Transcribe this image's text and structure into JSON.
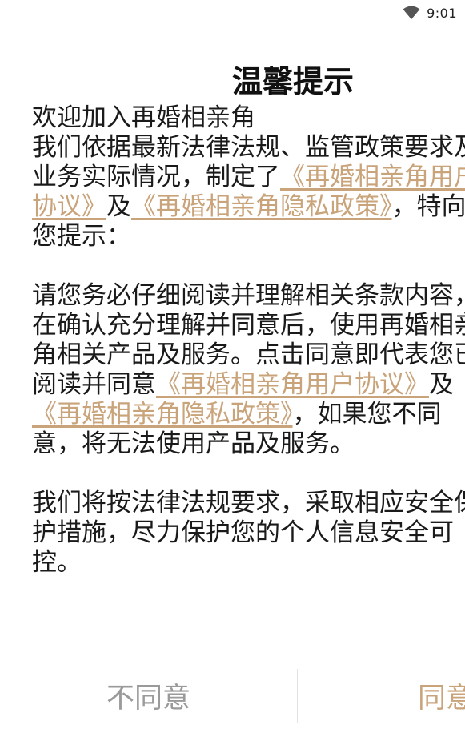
{
  "status_bar": {
    "time": "9:01",
    "icons": [
      "wifi-icon"
    ]
  },
  "dialog": {
    "title": "温馨提示",
    "welcome": "欢迎加入再婚相亲角",
    "p1_pre": "我们依据最新法律法规、监管政策要求及业务实际情况，制定了",
    "link_user_agreement": "《再婚相亲角用户协议》",
    "and": "及",
    "link_privacy_policy": "《再婚相亲角隐私政策》",
    "p1_post": "，特向您提示：",
    "p2_pre": "请您务必仔细阅读并理解相关条款内容，在确认充分理解并同意后，使用再婚相亲角相关产品及服务。点击同意即代表您已阅读并同意",
    "p2_post": "，如果您不同意，将无法使用产品及服务。",
    "p3": "我们将按法律法规要求，采取相应安全保护措施，尽力保护您的个人信息安全可控。",
    "disagree_label": "不同意",
    "agree_label": "同意"
  },
  "colors": {
    "accent": "#c9a37a",
    "disagree_text": "#9a9a9a",
    "divider": "#e6e6e6"
  }
}
